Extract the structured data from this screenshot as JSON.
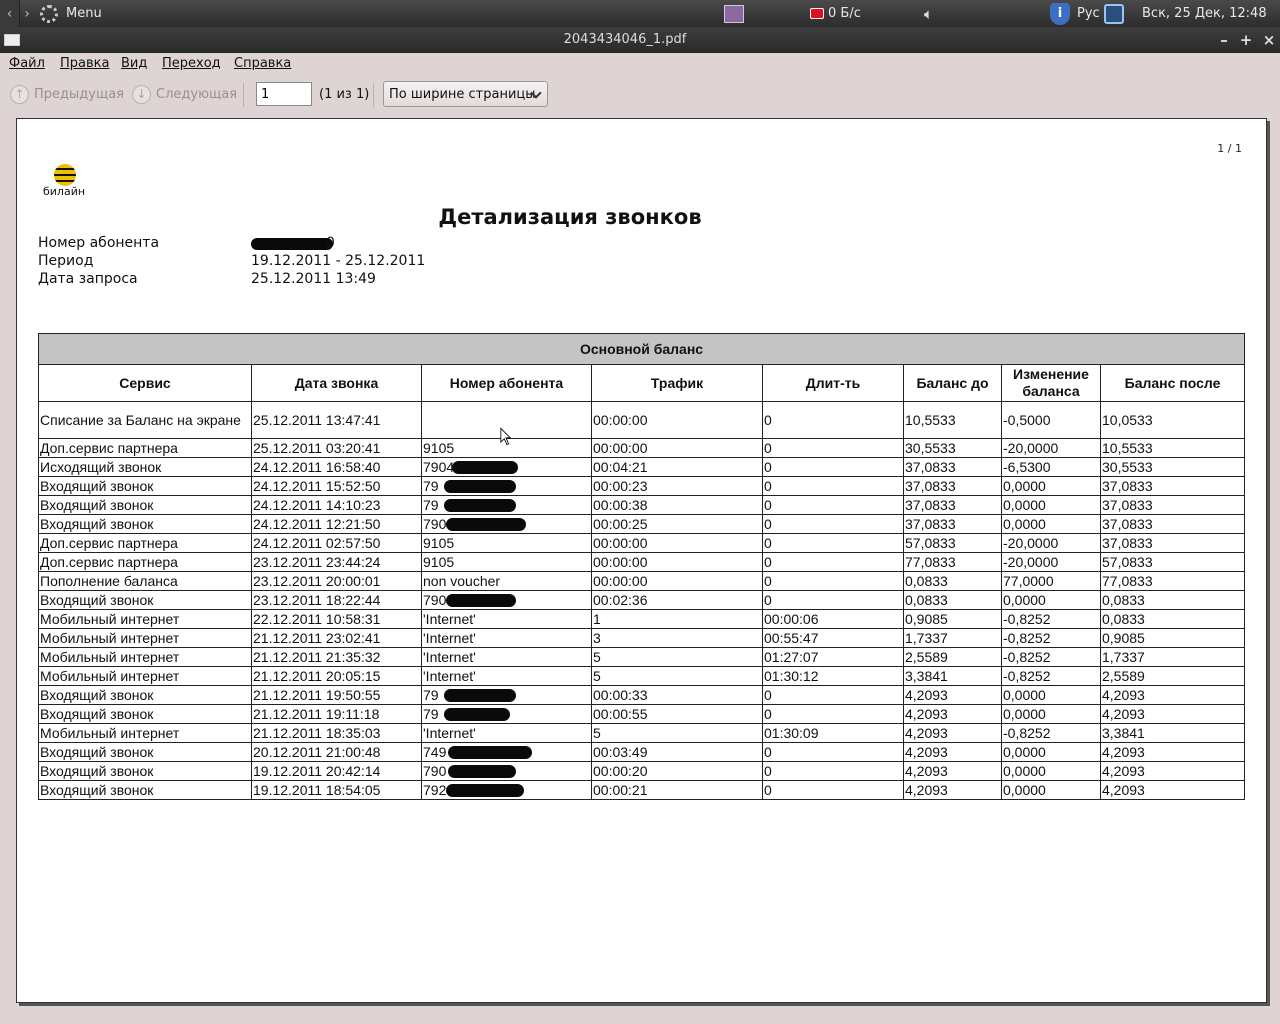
{
  "panel": {
    "menu_label": "Menu",
    "net_speed": "0 Б/с",
    "language": "Рус",
    "clock": "Вск, 25 Дек, 12:48"
  },
  "window": {
    "title": "2043434046_1.pdf"
  },
  "menubar": {
    "items": [
      "Файл",
      "Правка",
      "Вид",
      "Переход",
      "Справка"
    ]
  },
  "toolbar": {
    "prev_label": "Предыдущая",
    "next_label": "Следующая",
    "page_value": "1",
    "page_of": "(1 из 1)",
    "zoom_value": "По ширине страницы"
  },
  "document": {
    "page_number": "1 / 1",
    "logo_text": "билайн",
    "title": "Детализация звонков",
    "info": [
      {
        "label": "Номер абонента",
        "value": "0"
      },
      {
        "label": "Период",
        "value": "19.12.2011 - 25.12.2011"
      },
      {
        "label": "Дата запроса",
        "value": "25.12.2011 13:49"
      }
    ],
    "table": {
      "group_header": "Основной баланс",
      "columns": [
        "Сервис",
        "Дата звонка",
        "Номер абонента",
        "Трафик",
        "Длит-ть",
        "Баланс до",
        "Изменение баланса",
        "Баланс после"
      ],
      "rows": [
        [
          "Списание за Баланс на экране",
          "25.12.2011 13:47:41",
          "",
          "00:00:00",
          "0",
          "10,5533",
          "-0,5000",
          "10,0533"
        ],
        [
          "Доп.сервис партнера",
          "25.12.2011 03:20:41",
          "9105",
          "00:00:00",
          "0",
          "30,5533",
          "-20,0000",
          "10,5533"
        ],
        [
          "Исходящий звонок",
          "24.12.2011 16:58:40",
          "7904",
          "00:04:21",
          "0",
          "37,0833",
          "-6,5300",
          "30,5533"
        ],
        [
          "Входящий звонок",
          "24.12.2011 15:52:50",
          "79",
          "00:00:23",
          "0",
          "37,0833",
          "0,0000",
          "37,0833"
        ],
        [
          "Входящий звонок",
          "24.12.2011 14:10:23",
          "79",
          "00:00:38",
          "0",
          "37,0833",
          "0,0000",
          "37,0833"
        ],
        [
          "Входящий звонок",
          "24.12.2011 12:21:50",
          "790",
          "00:00:25",
          "0",
          "37,0833",
          "0,0000",
          "37,0833"
        ],
        [
          "Доп.сервис партнера",
          "24.12.2011 02:57:50",
          "9105",
          "00:00:00",
          "0",
          "57,0833",
          "-20,0000",
          "37,0833"
        ],
        [
          "Доп.сервис партнера",
          "23.12.2011 23:44:24",
          "9105",
          "00:00:00",
          "0",
          "77,0833",
          "-20,0000",
          "57,0833"
        ],
        [
          "Пополнение баланса",
          "23.12.2011 20:00:01",
          "non voucher",
          "00:00:00",
          "0",
          "0,0833",
          "77,0000",
          "77,0833"
        ],
        [
          "Входящий звонок",
          "23.12.2011 18:22:44",
          "790",
          "00:02:36",
          "0",
          "0,0833",
          "0,0000",
          "0,0833"
        ],
        [
          "Мобильный интернет",
          "22.12.2011 10:58:31",
          "'Internet'",
          "1",
          "00:00:06",
          "0,9085",
          "-0,8252",
          "0,0833"
        ],
        [
          "Мобильный интернет",
          "21.12.2011 23:02:41",
          "'Internet'",
          "3",
          "00:55:47",
          "1,7337",
          "-0,8252",
          "0,9085"
        ],
        [
          "Мобильный интернет",
          "21.12.2011 21:35:32",
          "'Internet'",
          "5",
          "01:27:07",
          "2,5589",
          "-0,8252",
          "1,7337"
        ],
        [
          "Мобильный интернет",
          "21.12.2011 20:05:15",
          "'Internet'",
          "5",
          "01:30:12",
          "3,3841",
          "-0,8252",
          "2,5589"
        ],
        [
          "Входящий звонок",
          "21.12.2011 19:50:55",
          "79",
          "00:00:33",
          "0",
          "4,2093",
          "0,0000",
          "4,2093"
        ],
        [
          "Входящий звонок",
          "21.12.2011 19:11:18",
          "79",
          "00:00:55",
          "0",
          "4,2093",
          "0,0000",
          "4,2093"
        ],
        [
          "Мобильный интернет",
          "21.12.2011 18:35:03",
          "'Internet'",
          "5",
          "01:30:09",
          "4,2093",
          "-0,8252",
          "3,3841"
        ],
        [
          "Входящий звонок",
          "20.12.2011 21:00:48",
          "749",
          "00:03:49",
          "0",
          "4,2093",
          "0,0000",
          "4,2093"
        ],
        [
          "Входящий звонок",
          "19.12.2011 20:42:14",
          "790",
          "00:00:20",
          "0",
          "4,2093",
          "0,0000",
          "4,2093"
        ],
        [
          "Входящий звонок",
          "19.12.2011 18:54:05",
          "792",
          "00:00:21",
          "0",
          "4,2093",
          "0,0000",
          "4,2093"
        ]
      ]
    }
  }
}
